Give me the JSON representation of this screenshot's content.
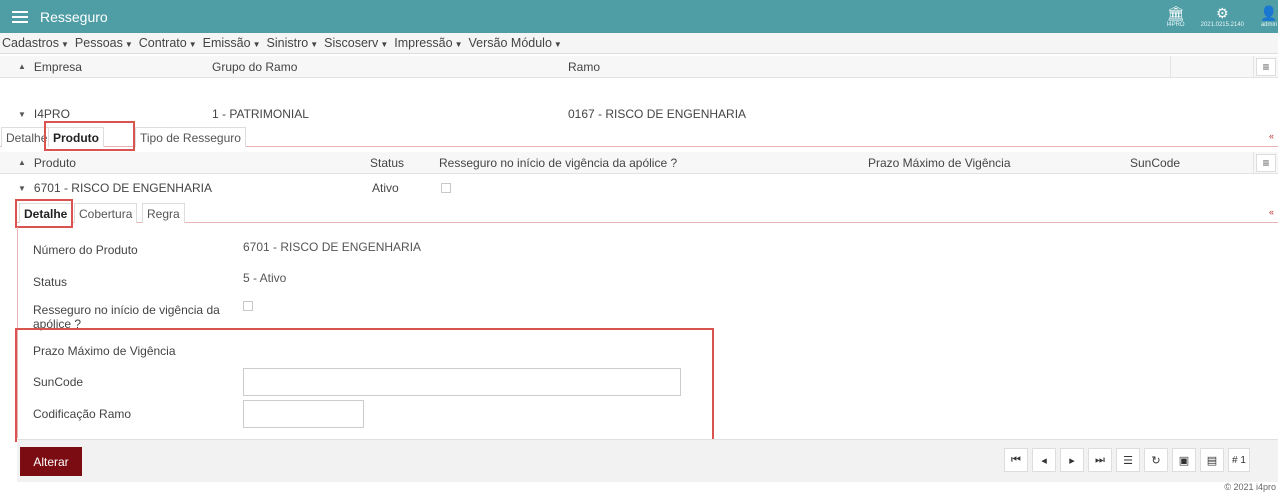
{
  "app": {
    "title": "Resseguro"
  },
  "topbar": {
    "tools": [
      {
        "icon": "bank-icon",
        "caption": "I4PRO"
      },
      {
        "icon": "gear-icon",
        "caption": "2021.0215.2140"
      },
      {
        "icon": "user-icon",
        "caption": "admin"
      }
    ]
  },
  "menu": {
    "items": [
      "Cadastros",
      "Pessoas",
      "Contrato",
      "Emissão",
      "Sinistro",
      "Siscoserv",
      "Impressão",
      "Versão Módulo"
    ]
  },
  "grid1": {
    "headers": {
      "empresa": "Empresa",
      "grupo": "Grupo do Ramo",
      "ramo": "Ramo"
    },
    "row": {
      "empresa": "I4PRO",
      "grupo": "1 - PATRIMONIAL",
      "ramo": "0167 - RISCO DE ENGENHARIA"
    }
  },
  "tabs1": {
    "detalhe": "Detalhe",
    "produto": "Produto",
    "tipo": "Tipo de Resseguro"
  },
  "grid2": {
    "headers": {
      "produto": "Produto",
      "status": "Status",
      "resseguro": "Resseguro no início de vigência da apólice ?",
      "prazo": "Prazo Máximo de Vigência",
      "suncode": "SunCode"
    },
    "row": {
      "produto": "6701 - RISCO DE ENGENHARIA",
      "status": "Ativo"
    }
  },
  "tabs2": {
    "detalhe": "Detalhe",
    "cobertura": "Cobertura",
    "regra": "Regra"
  },
  "form": {
    "numero_label": "Número do Produto",
    "numero_value": "6701 - RISCO DE ENGENHARIA",
    "status_label": "Status",
    "status_value": "5 - Ativo",
    "resseguro_label_1": "Resseguro no início de vigência da",
    "resseguro_label_2": "apólice ?",
    "prazo_label": "Prazo Máximo de Vigência",
    "suncode_label": "SunCode",
    "suncode_value": "",
    "codificacao_label": "Codificação Ramo",
    "codificacao_value": ""
  },
  "actions": {
    "alterar": "Alterar",
    "page_label": "# 1"
  },
  "footer": {
    "copyright": "© 2021 i4pro"
  }
}
